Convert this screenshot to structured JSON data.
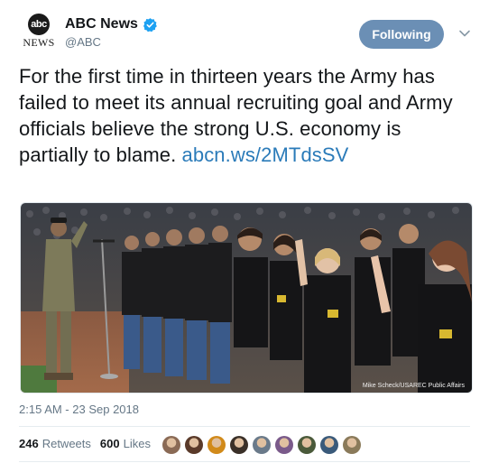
{
  "account": {
    "avatar_short": "abc",
    "avatar_word": "NEWS",
    "display_name": "ABC News",
    "handle": "@ABC"
  },
  "follow_button": {
    "label": "Following"
  },
  "tweet": {
    "text": "For the first time in thirteen years the Army has failed to meet its annual recruiting goal and Army officials believe the strong U.S. economy is partially to blame.",
    "link": "abcn.ws/2MTdsSV",
    "photo_credit": "Mike Scheck/USAREC Public Affairs",
    "timestamp": "2:15 AM - 23 Sep 2018"
  },
  "stats": {
    "retweets_count": "246",
    "retweets_label": "Retweets",
    "likes_count": "600",
    "likes_label": "Likes"
  },
  "likers": [
    {
      "color": "#8a6a55"
    },
    {
      "color": "#5a3a2a"
    },
    {
      "color": "#d18a1a"
    },
    {
      "color": "#3a3028"
    },
    {
      "color": "#6a7a8a"
    },
    {
      "color": "#7a5a8a"
    },
    {
      "color": "#4a5a3a"
    },
    {
      "color": "#3a5a7a"
    },
    {
      "color": "#8a7a5a"
    }
  ],
  "colors": {
    "follow_bg": "#6b8fb5",
    "link": "#2b7bb9",
    "verified": "#1da1f2"
  }
}
